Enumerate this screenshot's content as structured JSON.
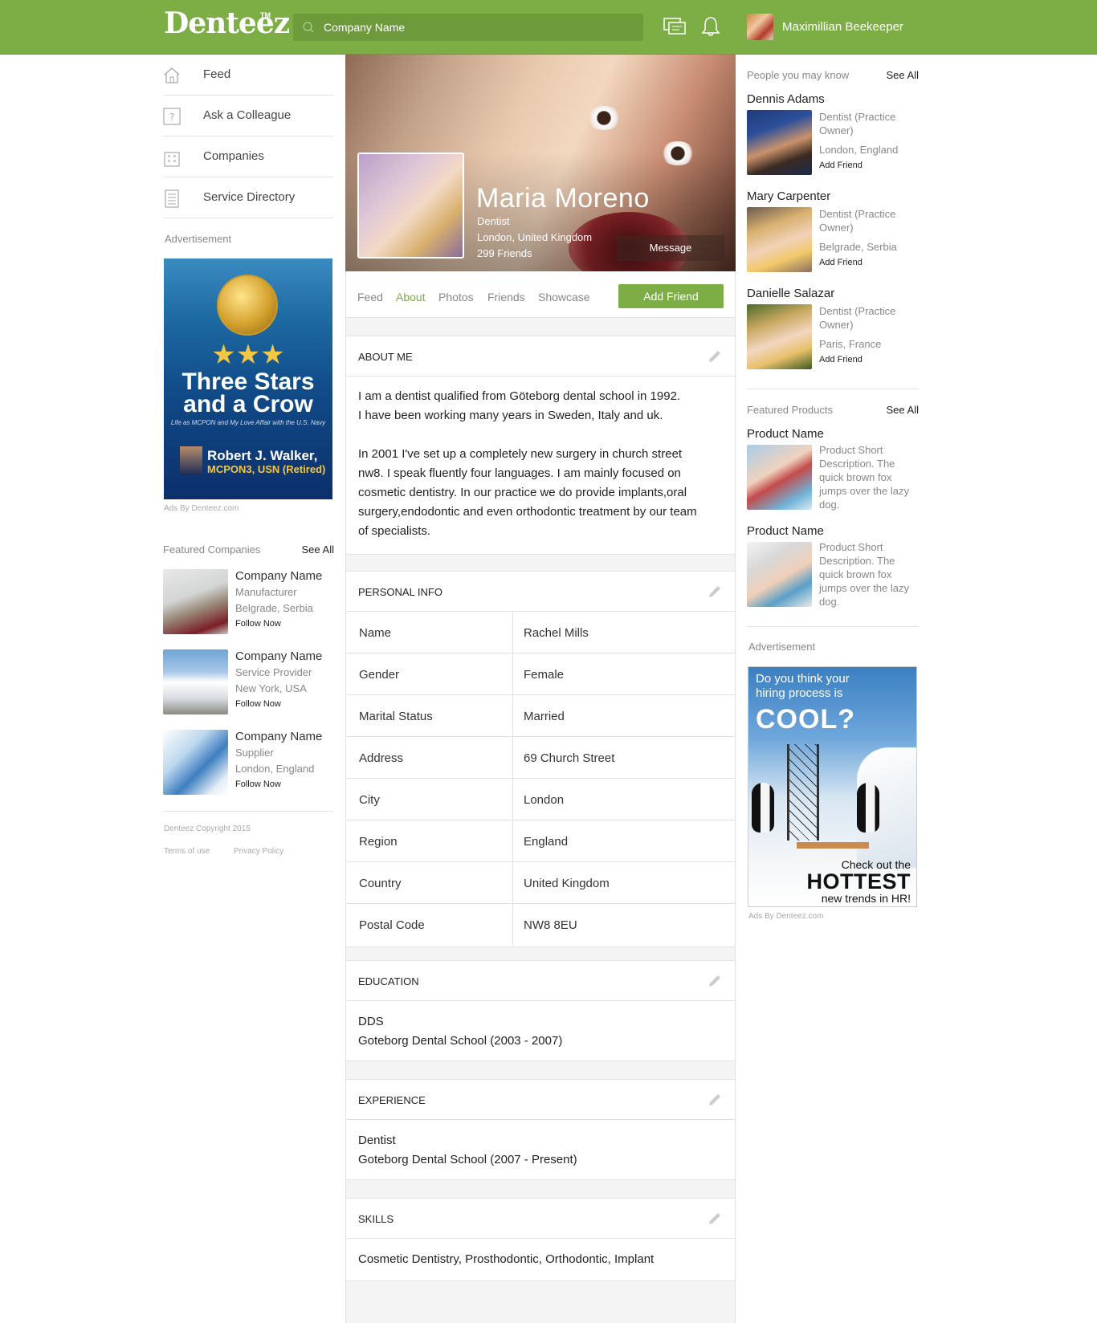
{
  "header": {
    "logo": "Denteez",
    "logo_tm": "TM",
    "search_placeholder": "Company Name",
    "user_name": "Maximillian Beekeeper",
    "brand_color": "#7dae45"
  },
  "nav": {
    "items": [
      {
        "label": "Feed",
        "icon": "home-icon"
      },
      {
        "label": "Ask a Colleague",
        "icon": "question-icon"
      },
      {
        "label": "Companies",
        "icon": "building-icon"
      },
      {
        "label": "Service Directory",
        "icon": "directory-icon"
      }
    ]
  },
  "left_ad": {
    "label": "Advertisement",
    "title_line1": "Three Stars",
    "title_line2": "and a Crow",
    "subtitle": "Life as MCPON and My Love Affair with the U.S. Navy",
    "author": "Robert J. Walker,",
    "author_rank": "MCPON3, USN (Retired)",
    "credit": "Ads By Denteez.com"
  },
  "featured_companies": {
    "label": "Featured Companies",
    "see_all": "See All",
    "items": [
      {
        "name": "Company Name",
        "type": "Manufacturer",
        "location": "Belgrade, Serbia",
        "action": "Follow Now"
      },
      {
        "name": "Company Name",
        "type": "Service Provider",
        "location": "New York, USA",
        "action": "Follow Now"
      },
      {
        "name": "Company Name",
        "type": "Supplier",
        "location": "London, England",
        "action": "Follow Now"
      }
    ]
  },
  "footer": {
    "copyright": "Denteez Copyright 2015",
    "terms": "Terms of use",
    "privacy": "Privacy Policy"
  },
  "profile": {
    "name": "Maria Moreno",
    "title": "Dentist",
    "location": "London, United Kingdom",
    "friends": "299 Friends",
    "message_btn": "Message",
    "tabs": [
      "Feed",
      "About",
      "Photos",
      "Friends",
      "Showcase"
    ],
    "active_tab": "About",
    "add_friend_btn": "Add Friend"
  },
  "about": {
    "heading": "ABOUT ME",
    "p1_l1": "I am a dentist qualified from Göteborg dental school in 1992.",
    "p1_l2": "I have been working many years in Sweden, Italy and uk.",
    "p2_l1": "In 2001 I've set up a completely new surgery in church street",
    "p2_l2": "nw8. I speak fluently four languages. I am mainly focused on",
    "p2_l3": "cosmetic dentistry. In our practice we do provide implants,oral",
    "p2_l4": "surgery,endodontic and even orthodontic treatment by our team",
    "p2_l5": "of specialists."
  },
  "personal_info": {
    "heading": "PERSONAL INFO",
    "rows": [
      {
        "key": "Name",
        "value": "Rachel Mills"
      },
      {
        "key": "Gender",
        "value": "Female"
      },
      {
        "key": "Marital Status",
        "value": "Married"
      },
      {
        "key": "Address",
        "value": "69 Church Street"
      },
      {
        "key": "City",
        "value": "London"
      },
      {
        "key": "Region",
        "value": "England"
      },
      {
        "key": "Country",
        "value": "United Kingdom"
      },
      {
        "key": "Postal Code",
        "value": "NW8 8EU"
      }
    ]
  },
  "education": {
    "heading": "EDUCATION",
    "degree": "DDS",
    "school": "Goteborg Dental School (2003 - 2007)"
  },
  "experience": {
    "heading": "EXPERIENCE",
    "role": "Dentist",
    "place": "Goteborg Dental School (2007 - Present)"
  },
  "skills": {
    "heading": "SKILLS",
    "list": "Cosmetic Dentistry, Prosthodontic, Orthodontic, Implant"
  },
  "people": {
    "label": "People you may know",
    "see_all": "See All",
    "items": [
      {
        "name": "Dennis Adams",
        "role": "Dentist (Practice Owner)",
        "location": "London, England",
        "action": "Add Friend"
      },
      {
        "name": "Mary Carpenter",
        "role": "Dentist (Practice Owner)",
        "location": "Belgrade, Serbia",
        "action": "Add Friend"
      },
      {
        "name": "Danielle Salazar",
        "role": "Dentist (Practice Owner)",
        "location": "Paris, France",
        "action": "Add Friend"
      }
    ]
  },
  "products": {
    "label": "Featured Products",
    "see_all": "See All",
    "items": [
      {
        "name": "Product Name",
        "desc": "Product Short Description. The quick brown fox jumps over the lazy dog."
      },
      {
        "name": "Product Name",
        "desc": "Product Short Description. The quick brown fox jumps over the lazy dog."
      }
    ]
  },
  "right_ad": {
    "label": "Advertisement",
    "question": "Do you think your hiring process is",
    "cool": "COOL?",
    "line1": "Check out the",
    "line2": "HOTTEST",
    "line3": "new trends in HR!",
    "credit": "Ads By Denteez.com"
  }
}
